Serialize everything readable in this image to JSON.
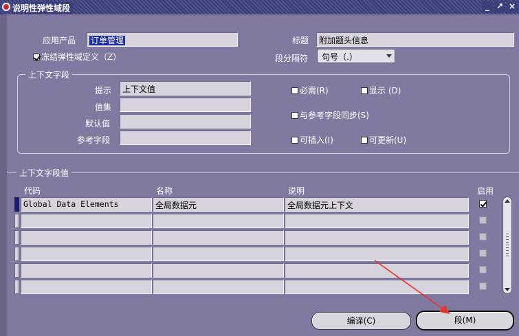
{
  "window": {
    "title": "说明性弹性域段",
    "btn_min": "_",
    "btn_max": "↗",
    "btn_close": "×"
  },
  "header": {
    "app_label": "应用产品",
    "app_value": "订单管理",
    "title_label": "标题",
    "title_value": "附加题头信息",
    "freeze_label": "冻结弹性域定义（Z）",
    "separator_label": "段分隔符",
    "separator_value": "句号（.）"
  },
  "context": {
    "group_title": "上下文字段",
    "prompt_label": "提示",
    "prompt_value": "上下文值",
    "valueset_label": "值集",
    "default_label": "默认值",
    "ref_label": "参考字段",
    "required_label": "必需(R)",
    "display_label": "显示 (D)",
    "sync_label": "与参考字段同步(S)",
    "insertable_label": "可插入(I)",
    "updatable_label": "可更新(U)"
  },
  "values": {
    "section_title": "上下文字段值",
    "columns": {
      "code": "代码",
      "name": "名称",
      "desc": "说明",
      "enabled": "启用"
    },
    "rows": [
      {
        "code": "Global Data Elements",
        "name": "全局数据元",
        "desc": "全局数据元上下文",
        "enabled": true
      },
      {
        "code": "",
        "name": "",
        "desc": "",
        "enabled": false
      },
      {
        "code": "",
        "name": "",
        "desc": "",
        "enabled": false
      },
      {
        "code": "",
        "name": "",
        "desc": "",
        "enabled": false
      },
      {
        "code": "",
        "name": "",
        "desc": "",
        "enabled": false
      },
      {
        "code": "",
        "name": "",
        "desc": "",
        "enabled": false
      }
    ]
  },
  "buttons": {
    "compile": "编译(C)",
    "segments": "段(M)"
  },
  "colors": {
    "accent": "#1c2d9c",
    "annotation_arrow": "#e8342b"
  }
}
